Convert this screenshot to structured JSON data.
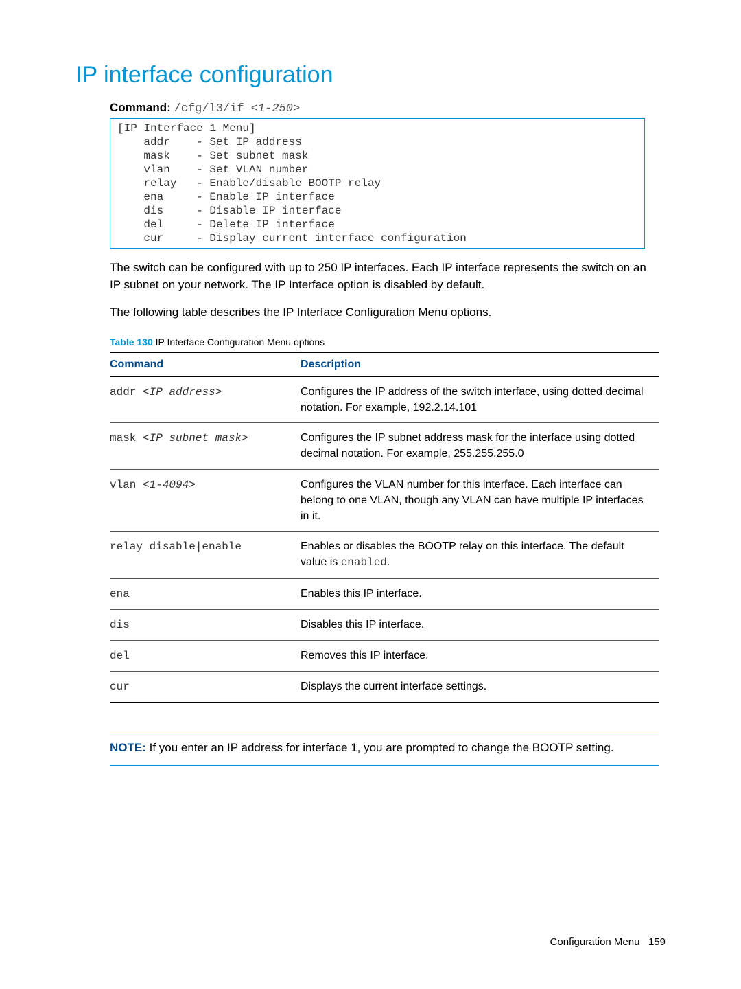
{
  "title": "IP interface configuration",
  "command_line": {
    "label": "Command:",
    "path": "/cfg/l3/if ",
    "arg": "<1-250>"
  },
  "codebox": "[IP Interface 1 Menu]\n    addr    - Set IP address\n    mask    - Set subnet mask\n    vlan    - Set VLAN number\n    relay   - Enable/disable BOOTP relay\n    ena     - Enable IP interface\n    dis     - Disable IP interface\n    del     - Delete IP interface\n    cur     - Display current interface configuration",
  "para1": "The switch can be configured with up to 250 IP interfaces. Each IP interface represents the switch on an IP subnet on your network. The IP Interface option is disabled by default.",
  "para2": "The following table describes the IP Interface Configuration Menu options.",
  "table_caption": {
    "num": "Table 130",
    "text": "  IP Interface Configuration Menu options"
  },
  "table_headers": {
    "cmd": "Command",
    "desc": "Description"
  },
  "rows": [
    {
      "cmd_prefix": "addr ",
      "cmd_arg": "<IP address>",
      "desc": "Configures the IP address of the switch interface, using dotted decimal notation. For example, 192.2.14.101"
    },
    {
      "cmd_prefix": "mask ",
      "cmd_arg": "<IP subnet mask>",
      "desc": "Configures the IP subnet address mask for the interface using dotted decimal notation. For example, 255.255.255.0"
    },
    {
      "cmd_prefix": "vlan ",
      "cmd_arg": "<1-4094>",
      "desc": "Configures the VLAN number for this interface. Each interface can belong to one VLAN, though any VLAN can have multiple IP interfaces in it."
    },
    {
      "cmd_prefix": "relay disable|enable",
      "cmd_arg": "",
      "desc_pre": "Enables or disables the BOOTP relay on this interface. The default value is ",
      "desc_mono": "enabled",
      "desc_post": "."
    },
    {
      "cmd_prefix": "ena",
      "cmd_arg": "",
      "desc": "Enables this IP interface."
    },
    {
      "cmd_prefix": "dis",
      "cmd_arg": "",
      "desc": "Disables this IP interface."
    },
    {
      "cmd_prefix": "del",
      "cmd_arg": "",
      "desc": "Removes this IP interface."
    },
    {
      "cmd_prefix": "cur",
      "cmd_arg": "",
      "desc": "Displays the current interface settings."
    }
  ],
  "note": {
    "label": "NOTE:",
    "text": " If you enter an IP address for interface 1, you are prompted to change the BOOTP setting."
  },
  "footer": {
    "section": "Configuration Menu",
    "page": "159"
  }
}
